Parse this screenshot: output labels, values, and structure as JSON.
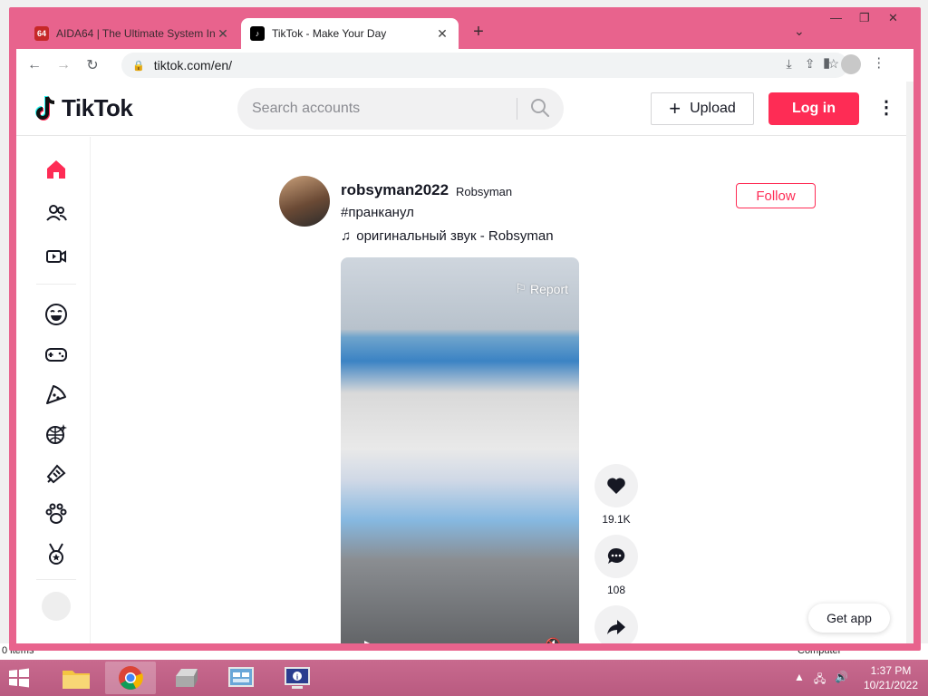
{
  "background": {
    "status_left": "0 items",
    "status_right": "Computer"
  },
  "browser": {
    "tabs": [
      {
        "title": "AIDA64 | The Ultimate System In",
        "favicon": "64",
        "active": false
      },
      {
        "title": "TikTok - Make Your Day",
        "favicon": "tiktok-icon",
        "active": true
      }
    ],
    "url": "tiktok.com/en/"
  },
  "tiktok": {
    "logo_text": "TikTok",
    "search_placeholder": "Search accounts",
    "upload_label": "Upload",
    "login_label": "Log in",
    "brand_color": "#fe2c55",
    "sidebar_icons": [
      "home-icon",
      "following-icon",
      "live-icon",
      "comedy-icon",
      "gaming-icon",
      "food-icon",
      "dance-icon",
      "beauty-icon",
      "animals-icon",
      "sports-icon"
    ]
  },
  "post": {
    "username": "robsyman2022",
    "nickname": "Robsyman",
    "caption": "#пранканул",
    "music": "оригинальный звук - Robsyman",
    "follow_label": "Follow",
    "report_label": "Report",
    "likes": "19.1K",
    "comments": "108"
  },
  "getapp_label": "Get app",
  "taskbar": {
    "time": "1:37 PM",
    "date": "10/21/2022"
  }
}
